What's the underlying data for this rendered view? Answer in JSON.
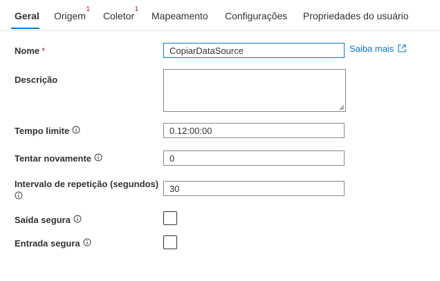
{
  "tabs": [
    {
      "label": "Geral",
      "badge": ""
    },
    {
      "label": "Origem",
      "badge": "1"
    },
    {
      "label": "Coletor",
      "badge": "1"
    },
    {
      "label": "Mapeamento",
      "badge": ""
    },
    {
      "label": "Configurações",
      "badge": ""
    },
    {
      "label": "Propriedades do usuário",
      "badge": ""
    }
  ],
  "form": {
    "name": {
      "label": "Nome",
      "required_mark": "*",
      "value": "CopiarDataSource"
    },
    "learn_more": "Saiba mais",
    "description": {
      "label": "Descrição",
      "value": ""
    },
    "timeout": {
      "label": "Tempo limite",
      "value": "0.12:00:00"
    },
    "retry": {
      "label": "Tentar novamente",
      "value": "0"
    },
    "retry_interval": {
      "label": "Intervalo de repetição (segundos)",
      "value": "30"
    },
    "secure_output": {
      "label": "Saída segura",
      "checked": false
    },
    "secure_input": {
      "label": "Entrada segura",
      "checked": false
    }
  },
  "colors": {
    "accent": "#0078d4",
    "required": "#a4262c",
    "text": "#323130"
  }
}
